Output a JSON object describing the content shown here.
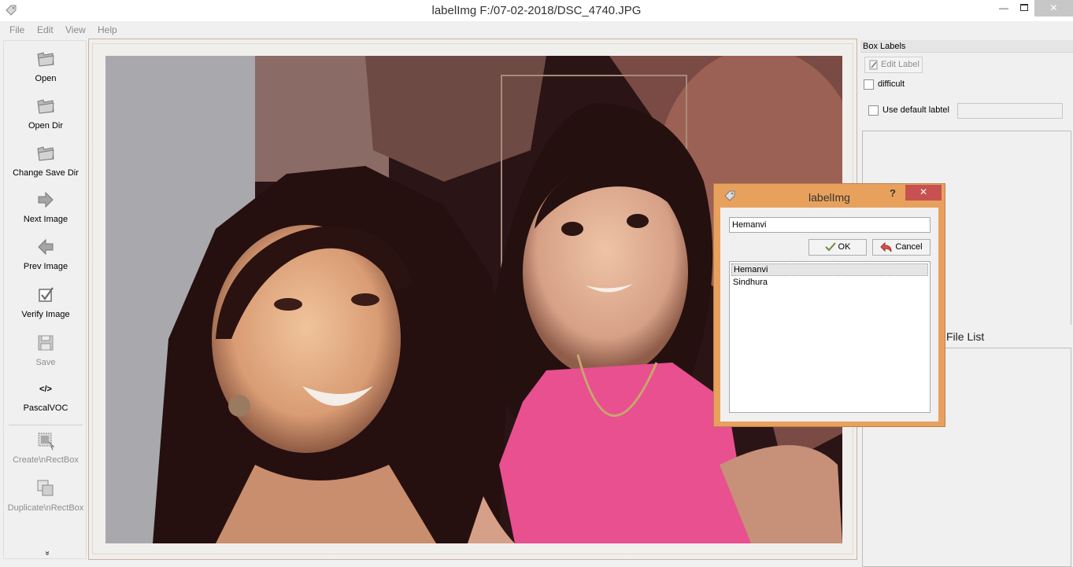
{
  "window": {
    "title": "labelImg F:/07-02-2018/DSC_4740.JPG",
    "minimize_glyph": "—",
    "close_glyph": "✕"
  },
  "menu": [
    "File",
    "Edit",
    "View",
    "Help"
  ],
  "toolbar": {
    "items": [
      {
        "label": "Open",
        "icon": "folder-open-icon",
        "enabled": true
      },
      {
        "label": "Open Dir",
        "icon": "folder-open-icon",
        "enabled": true
      },
      {
        "label": "Change Save Dir",
        "icon": "folder-open-icon",
        "enabled": true
      },
      {
        "label": "Next Image",
        "icon": "arrow-right-icon",
        "enabled": true
      },
      {
        "label": "Prev Image",
        "icon": "arrow-left-icon",
        "enabled": true
      },
      {
        "label": "Verify Image",
        "icon": "checkbox-icon",
        "enabled": true
      },
      {
        "label": "Save",
        "icon": "floppy-disk-icon",
        "enabled": false
      },
      {
        "label": "PascalVOC",
        "icon": "code-tag-icon",
        "enabled": true
      },
      {
        "label": "Create\\nRectBox",
        "icon": "create-rectbox-icon",
        "enabled": false
      },
      {
        "label": "Duplicate\\nRectBox",
        "icon": "duplicate-rectbox-icon",
        "enabled": false
      }
    ],
    "code_glyph": "</>",
    "more_glyph": "»"
  },
  "box_labels": {
    "title": "Box Labels",
    "edit_label_button": "Edit Label",
    "difficult_label": "difficult",
    "difficult_checked": false,
    "use_default_label": "Use default labtel",
    "use_default_checked": false,
    "default_label_value": ""
  },
  "file_list": {
    "title": "File List"
  },
  "dialog": {
    "title": "labelImg",
    "help_glyph": "?",
    "close_glyph": "✕",
    "input_value": "Hemanvi",
    "ok_label": "OK",
    "cancel_label": "Cancel",
    "labels": [
      "Hemanvi",
      "Sindhura"
    ],
    "selected_index": 0
  },
  "colors": {
    "dialog_frame": "#e8a15d",
    "close_red": "#c75050",
    "canvas_border": "#c9b39e"
  }
}
